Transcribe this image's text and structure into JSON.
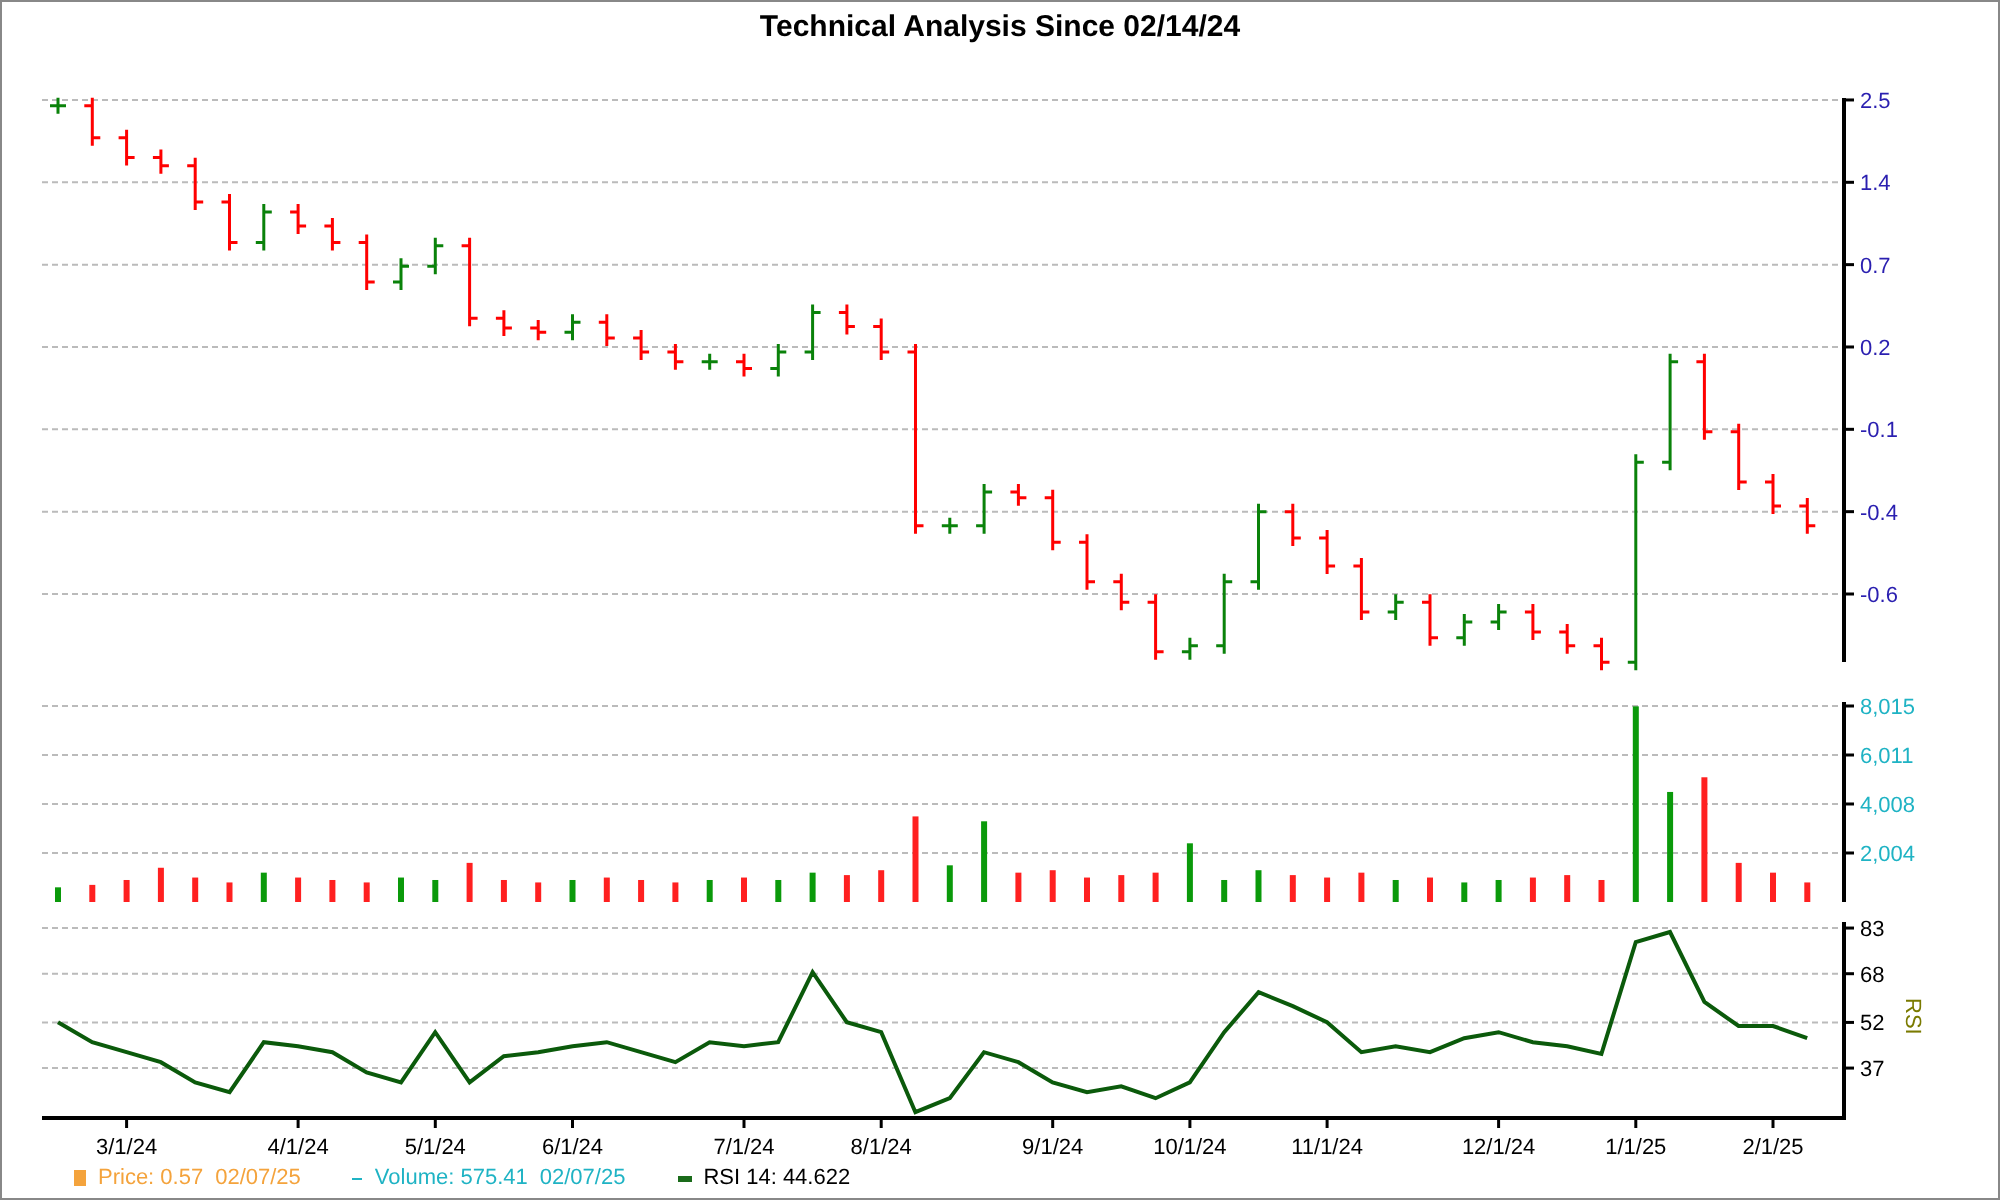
{
  "title": "Technical Analysis Since 02/14/24",
  "price_chart": {
    "kind": "picture",
    "axis_labels": [
      "2.5",
      "1.4",
      "0.7",
      "0.2",
      "-0.1",
      "-0.4",
      "-0.6"
    ]
  },
  "volume_chart": {
    "chart_data": {
      "type": "bar",
      "grid": true,
      "ylim": [
        0,
        8342
      ],
      "yticks": [
        {
          "value": 2004,
          "label": "2,004"
        },
        {
          "value": 4008,
          "label": "4,008"
        },
        {
          "value": 6011,
          "label": "6,011"
        },
        {
          "value": 8015,
          "label": "8,015"
        }
      ],
      "series": [
        {
          "values": [
            600,
            700,
            900,
            1400,
            1000,
            800,
            1200,
            1000,
            900,
            800,
            1000,
            900,
            1600,
            900,
            800,
            900,
            1000,
            900,
            800,
            900,
            1000,
            900,
            1200,
            1100,
            1300,
            3500,
            1500,
            3300,
            1200,
            1300,
            1000,
            1100,
            1200,
            2400,
            900,
            1300,
            1100,
            1000,
            1200,
            900,
            1000,
            800,
            900,
            1000,
            1100,
            900,
            8000,
            4500,
            5100,
            1600,
            1200,
            800
          ]
        }
      ]
    }
  },
  "rsi_chart": {
    "chart_data": {
      "type": "line",
      "grid": true,
      "ylabel": "RSI",
      "ylim": [
        20.6,
        86.3
      ],
      "categories": [
        null,
        null,
        "3/1/24",
        null,
        null,
        null,
        null,
        "4/1/24",
        null,
        null,
        null,
        "5/1/24",
        null,
        null,
        null,
        "6/1/24",
        null,
        null,
        null,
        null,
        "7/1/24",
        null,
        null,
        null,
        "8/1/24",
        null,
        null,
        null,
        null,
        "9/1/24",
        null,
        null,
        null,
        "10/1/24",
        null,
        null,
        null,
        "11/1/24",
        null,
        null,
        null,
        null,
        "12/1/24",
        null,
        null,
        null,
        "1/1/25",
        null,
        null,
        null,
        "2/1/25",
        null
      ],
      "yticks": [
        37,
        52,
        68,
        83
      ],
      "series": [
        {
          "color": "#0b5a0b",
          "values": [
            52.1,
            45.5,
            42.2,
            38.9,
            32.3,
            29.1,
            45.5,
            44.2,
            42.2,
            35.6,
            32.3,
            48.8,
            32.3,
            40.9,
            42.2,
            44.2,
            45.5,
            42.2,
            38.9,
            45.5,
            44.2,
            45.5,
            68.5,
            52.1,
            48.8,
            22.5,
            27.1,
            42.2,
            38.9,
            32.3,
            29.1,
            31.0,
            27.1,
            32.3,
            48.8,
            61.9,
            57.3,
            52.1,
            42.2,
            44.2,
            42.2,
            46.8,
            48.8,
            45.5,
            44.2,
            41.6,
            78.4,
            81.7,
            58.7,
            50.8,
            50.8,
            46.8
          ]
        }
      ]
    }
  },
  "legend": [
    {
      "kind": "square",
      "color": "#f4a33c",
      "text": "Price: 0.57",
      "date": "02/07/25"
    },
    {
      "kind": "dash",
      "color": "#1fb3c4",
      "text": "Volume: 575.41",
      "date": "02/07/25"
    },
    {
      "kind": "bar",
      "color": "#1a6b1a",
      "text": "RSI 14: 44.622"
    }
  ]
}
